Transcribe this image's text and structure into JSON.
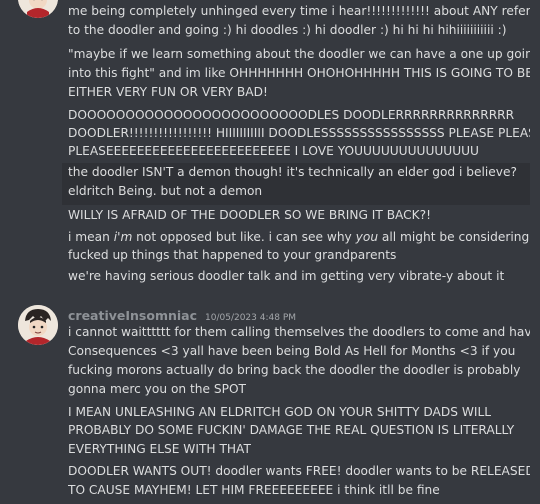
{
  "message1": {
    "lines": [
      "me being completely unhinged every time i hear!!!!!!!!!!!!! about ANY reference",
      "to the doodler and going :) hi doodles :) hi doodler :) hi hi hi hihiiiiiiiiiii :)",
      "\"maybe if we learn something about the doodler we can have a one up going",
      "into this fight\" and im like OHHHHHHH OHOHOHHHHH THIS IS GOING TO BE",
      "EITHER VERY FUN OR VERY BAD!",
      "DOOOOOOOOOOOOOOOOOOOOOOOODLES DOODLERRRRRRRRRRRRRR",
      "DOODLER!!!!!!!!!!!!!!!!! HIIIIIIIIIII DOODLESSSSSSSSSSSSSSSS PLEASE PLEASE",
      "PLEASEEEEEEEEEEEEEEEEEEEEEEEE I LOVE YOUUUUUUUUUUUUUU",
      "the doodler ISN'T a demon though! it's technically an elder god i believe?",
      "eldritch Being. but not a demon",
      "WILLY IS AFRAID OF THE DOODLER SO WE BRING IT BACK?!"
    ],
    "line12_pre": "i mean ",
    "line12_em1": "i'm",
    "line12_mid": " not opposed but like. i can see why ",
    "line12_em2": "you",
    "line12_post": " all might be considering the",
    "line13": "fucked up things that happened to your grandparents",
    "line14": "we're having serious doodler talk and im getting very vibrate-y about it"
  },
  "message2": {
    "username": "creativeInsomniac",
    "timestamp": "10/05/2023 4:48 PM",
    "lines": [
      "i cannot waitttttt for them calling themselves the doodlers to come and have",
      "Consequences <3 yall have been being Bold As Hell for Months <3 if you",
      "fucking morons actually do bring back the doodler the doodler is probably",
      "gonna merc you on the SPOT",
      "I MEAN UNLEASHING AN ELDRITCH GOD ON YOUR SHITTY DADS WILL",
      "PROBABLY DO SOME FUCKIN' DAMAGE THE REAL QUESTION IS LITERALLY",
      "EVERYTHING ELSE WITH THAT",
      "DOODLER WANTS OUT! doodler wants FREE! doodler wants to be RELEASED",
      "TO CAUSE MAYHEM! LET HIM FREEEEEEEEE i think itll be fine"
    ]
  }
}
